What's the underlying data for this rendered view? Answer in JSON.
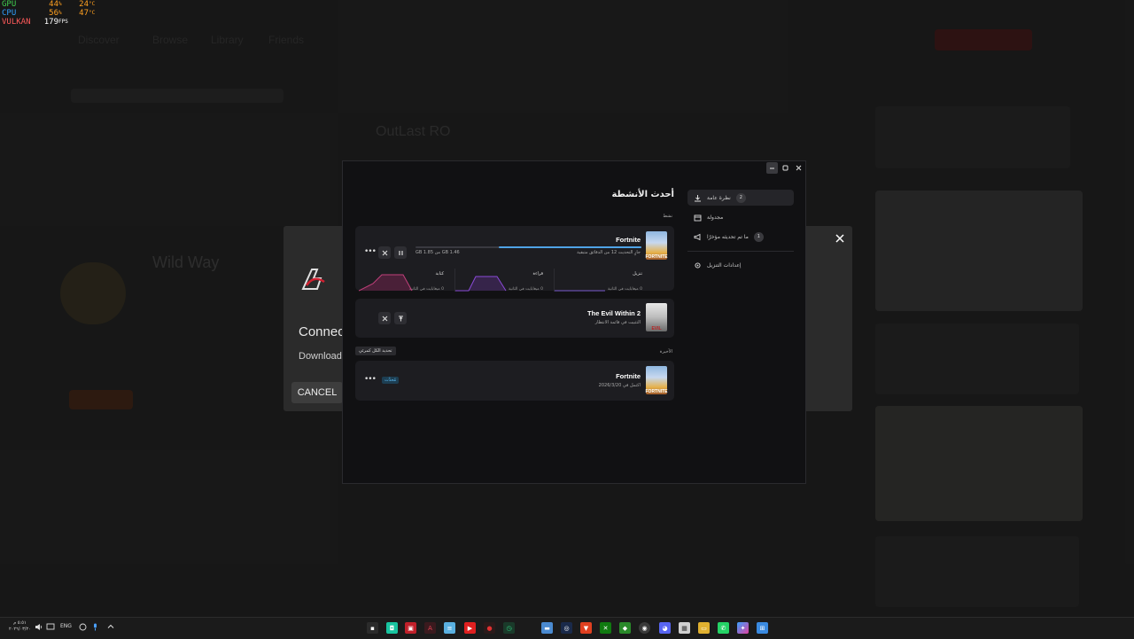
{
  "osd": {
    "rows": [
      {
        "label": "GPU",
        "v1": "44",
        "u1": "%",
        "v2": "24",
        "u2": "°C",
        "color": "#40d050"
      },
      {
        "label": "CPU",
        "v1": "56",
        "u1": "%",
        "v2": "47",
        "u2": "°C",
        "color": "#30a0ff"
      },
      {
        "label": "VULKAN",
        "v1": "179",
        "u1": "FPS",
        "v2": "",
        "u2": "",
        "color": "#ff5a5a"
      }
    ]
  },
  "background": {
    "game_title": "Wild Way",
    "outlast_title": "OutLast RO"
  },
  "back_dialog": {
    "connect_text": "Connec",
    "downloading_text": "Downloadi",
    "cancel_label": "CANCEL",
    "close_icon": "close-icon"
  },
  "window": {
    "title": "أحدث الأنشطة",
    "active_label": "نشط",
    "recent_label": "الأخيرة",
    "clear_all_label": "تحديد الكل كمرئي",
    "nav": [
      {
        "label": "نظرة عامة",
        "icon": "download-icon",
        "badge": "2"
      },
      {
        "label": "مجدولة",
        "icon": "calendar-icon",
        "badge": ""
      },
      {
        "label": "ما تم تحديثه مؤخرًا",
        "icon": "megaphone-icon",
        "badge": "1"
      },
      {
        "label": "إعدادات التنزيل",
        "icon": "gear-icon",
        "badge": ""
      }
    ],
    "active_downloads": [
      {
        "name": "Fortnite",
        "status": "جارٍ التحديث 12 من الدقائق متبقية",
        "size": "GB 1.85 من GB 1.46",
        "progress": 0.63,
        "thumb_label": "FORTNITE",
        "stats": [
          {
            "label": "تنزيل",
            "value": "0 ميغابايت في الثانية"
          },
          {
            "label": "قراءة",
            "value": "0 ميغابايت في الثانية"
          },
          {
            "label": "كتابة",
            "value": "0 ميغابايت في الثانية"
          }
        ]
      },
      {
        "name": "The Evil Within 2",
        "status": "التثبيت في قائمة الانتظار",
        "thumb_label": "EVIL"
      }
    ],
    "recent": [
      {
        "name": "Fortnite",
        "status": "اكتمل في 2026/3/20",
        "tag": "مُحدَّث",
        "thumb_label": "FORTNITE"
      }
    ]
  },
  "taskbar": {
    "lang": "ENG",
    "time": "٥:٥١ م",
    "date": "٢٠٢٦/٠٣/٢٠"
  }
}
